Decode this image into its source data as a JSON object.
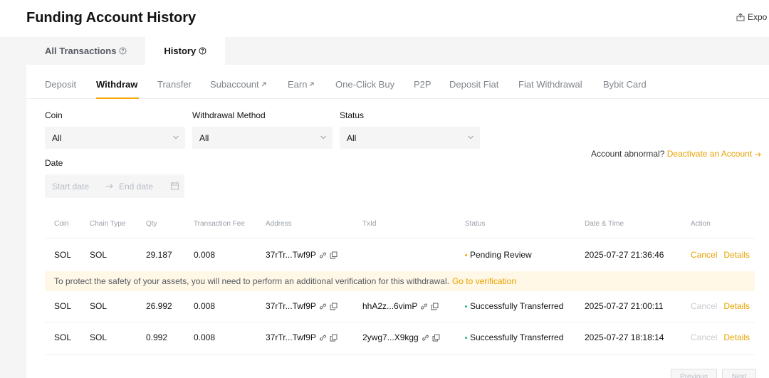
{
  "header": {
    "title": "Funding Account History",
    "export_label": "Expo"
  },
  "top_tabs": [
    {
      "label": "All Transactions",
      "active": false
    },
    {
      "label": "History",
      "active": true
    }
  ],
  "sub_tabs": [
    {
      "label": "Deposit",
      "active": false,
      "external": false
    },
    {
      "label": "Withdraw",
      "active": true,
      "external": false
    },
    {
      "label": "Transfer",
      "active": false,
      "external": false
    },
    {
      "label": "Subaccount",
      "active": false,
      "external": true
    },
    {
      "label": "Earn",
      "active": false,
      "external": true
    },
    {
      "label": "One-Click Buy",
      "active": false,
      "external": false
    },
    {
      "label": "P2P",
      "active": false,
      "external": false
    },
    {
      "label": "Deposit Fiat",
      "active": false,
      "external": false
    },
    {
      "label": "Fiat Withdrawal",
      "active": false,
      "external": false
    },
    {
      "label": "Bybit Card",
      "active": false,
      "external": false
    }
  ],
  "filters": {
    "coin": {
      "label": "Coin",
      "value": "All"
    },
    "method": {
      "label": "Withdrawal Method",
      "value": "All"
    },
    "status": {
      "label": "Status",
      "value": "All"
    },
    "date": {
      "label": "Date",
      "start_placeholder": "Start date",
      "end_placeholder": "End date"
    }
  },
  "account_note": {
    "text": "Account abnormal?",
    "link": "Deactivate an Account"
  },
  "table": {
    "columns": [
      "Coin",
      "Chain Type",
      "Qty",
      "Transaction Fee",
      "Address",
      "TxId",
      "Status",
      "Date & Time",
      "Action"
    ],
    "rows": [
      {
        "coin": "SOL",
        "chain": "SOL",
        "qty": "29.187",
        "fee": "0.008",
        "address": "37rTr...Twf9P",
        "txid": "",
        "status": "Pending Review",
        "status_color": "#f7a600",
        "datetime": "2025-07-27 21:36:46",
        "cancel": "Cancel",
        "cancel_enabled": true,
        "details": "Details"
      },
      {
        "coin": "SOL",
        "chain": "SOL",
        "qty": "26.992",
        "fee": "0.008",
        "address": "37rTr...Twf9P",
        "txid": "hhA2z...6vimP",
        "status": "Successfully Transferred",
        "status_color": "#20b26c",
        "datetime": "2025-07-27 21:00:11",
        "cancel": "Cancel",
        "cancel_enabled": false,
        "details": "Details"
      },
      {
        "coin": "SOL",
        "chain": "SOL",
        "qty": "0.992",
        "fee": "0.008",
        "address": "37rTr...Twf9P",
        "txid": "2ywg7...X9kgg",
        "status": "Successfully Transferred",
        "status_color": "#20b26c",
        "datetime": "2025-07-27 18:18:14",
        "cancel": "Cancel",
        "cancel_enabled": false,
        "details": "Details"
      }
    ],
    "notice": {
      "text": "To protect the safety of your assets, you will need to perform an additional verification for this withdrawal.",
      "link": "Go to verification"
    }
  },
  "pagination": {
    "previous": "Previous",
    "next": "Next"
  },
  "colors": {
    "accent": "#f7a600",
    "success": "#20b26c"
  }
}
